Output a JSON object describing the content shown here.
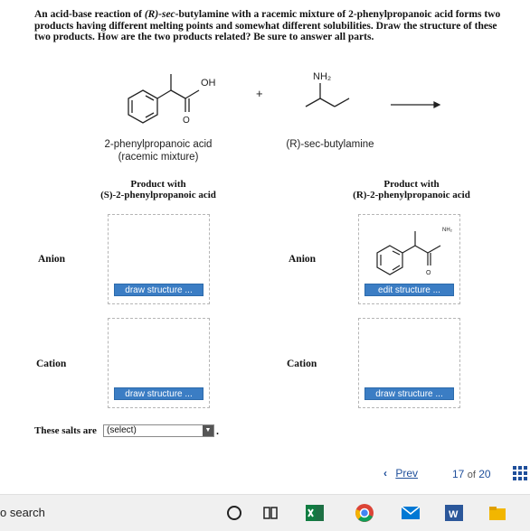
{
  "question": {
    "text_parts": [
      {
        "t": "An acid-base reaction of ",
        "i": false
      },
      {
        "t": "(R)-sec",
        "i": true
      },
      {
        "t": "-butylamine with a racemic mixture of 2-phenylpropanoic acid forms two products having different melting points and somewhat different solubilities. Draw the structure of these two products. How are the two products related? Be sure to answer all parts.",
        "i": false
      }
    ]
  },
  "reaction": {
    "acid_label_line1": "2-phenylpropanoic acid",
    "acid_label_line2": "(racemic mixture)",
    "amine_label": "(R)-sec-butylamine",
    "oh_label": "OH",
    "o_label": "O",
    "nh2_label": "NH₂",
    "plus": "+"
  },
  "columns": {
    "left_header_line1": "Product with",
    "left_header_line2": "(S)-2-phenylpropanoic acid",
    "right_header_line1": "Product with",
    "right_header_line2": "(R)-2-phenylpropanoic acid"
  },
  "rows": {
    "anion": "Anion",
    "cation": "Cation"
  },
  "buttons": {
    "draw": "draw structure ...",
    "edit": "edit structure ..."
  },
  "answer": {
    "prompt": "These salts are",
    "select_value": "(select)",
    "period": "."
  },
  "nav": {
    "prev": "Prev",
    "current": "17",
    "of": "of",
    "total": "20"
  },
  "taskbar": {
    "search": "o search"
  },
  "colors": {
    "button_blue": "#3b7dc4",
    "nav_blue": "#1f4f9b"
  }
}
